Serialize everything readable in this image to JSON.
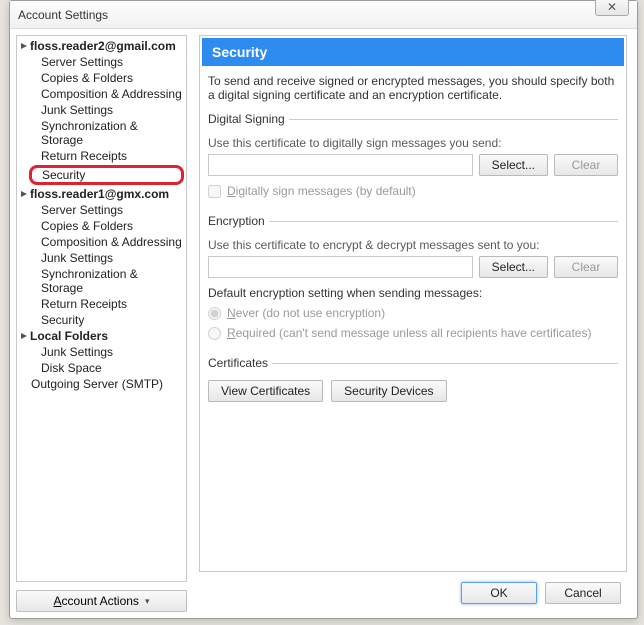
{
  "window": {
    "title": "Account Settings",
    "close_glyph": "✕"
  },
  "sidebar": {
    "accounts": [
      {
        "name": "floss.reader2@gmail.com",
        "items": [
          "Server Settings",
          "Copies & Folders",
          "Composition & Addressing",
          "Junk Settings",
          "Synchronization & Storage",
          "Return Receipts",
          "Security"
        ],
        "highlight_index": 6,
        "active_index": 6
      },
      {
        "name": "floss.reader1@gmx.com",
        "items": [
          "Server Settings",
          "Copies & Folders",
          "Composition & Addressing",
          "Junk Settings",
          "Synchronization & Storage",
          "Return Receipts",
          "Security"
        ]
      },
      {
        "name": "Local Folders",
        "items": [
          "Junk Settings",
          "Disk Space"
        ]
      }
    ],
    "outgoing": "Outgoing Server (SMTP)",
    "account_actions": "Account Actions"
  },
  "panel": {
    "title": "Security",
    "intro": "To send and receive signed or encrypted messages, you should specify both a digital signing certificate and an encryption certificate.",
    "digital_signing": {
      "legend": "Digital Signing",
      "desc": "Use this certificate to digitally sign messages you send:",
      "select": "Select...",
      "clear": "Clear",
      "checkbox": "Digitally sign messages (by default)"
    },
    "encryption": {
      "legend": "Encryption",
      "desc": "Use this certificate to encrypt & decrypt messages sent to you:",
      "select": "Select...",
      "clear": "Clear",
      "default_label": "Default encryption setting when sending messages:",
      "never": "Never (do not use encryption)",
      "required": "Required (can't send message unless all recipients have certificates)"
    },
    "certificates": {
      "legend": "Certificates",
      "view": "View Certificates",
      "devices": "Security Devices"
    },
    "footer": {
      "ok": "OK",
      "cancel": "Cancel"
    }
  }
}
